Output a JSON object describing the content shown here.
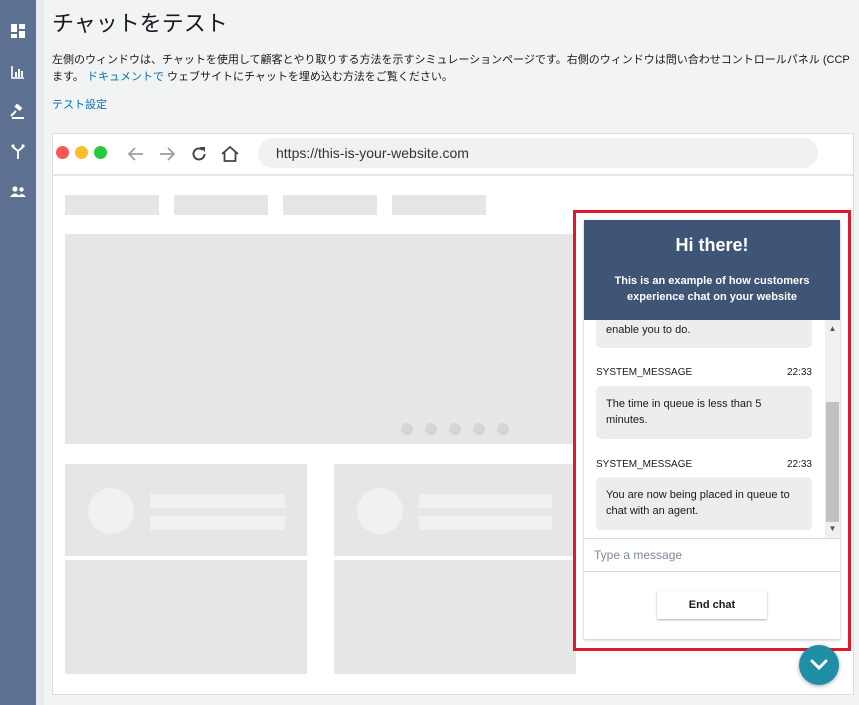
{
  "sidebar": {
    "icons": [
      "dashboard-icon",
      "metrics-icon",
      "routing-icon",
      "flow-icon",
      "users-icon"
    ]
  },
  "page": {
    "title": "チャットをテスト",
    "desc_line1": "左側のウィンドウは、チャットを使用して顧客とやり取りする方法を示すシミュレーションページです。右側のウィンドウは問い合わせコントロールパネル (CCP",
    "desc_line2_a": "ます。",
    "desc_link": "ドキュメントで",
    "desc_line2_b": "ウェブサイトにチャットを埋め込む方法をご覧ください。",
    "settings_link": "テスト設定"
  },
  "browser": {
    "url": "https://this-is-your-website.com",
    "dot_colors": [
      "#f45a52",
      "#f9be2d",
      "#28c840"
    ]
  },
  "chat": {
    "header_title": "Hi there!",
    "header_sub": "This is an example of how customers experience chat on your website",
    "messages": [
      {
        "text": "enable you to do."
      },
      {
        "sender": "SYSTEM_MESSAGE",
        "time": "22:33",
        "text": "The time in queue is less than 5 minutes."
      },
      {
        "sender": "SYSTEM_MESSAGE",
        "time": "22:33",
        "text": "You are now being placed in queue to chat with an agent."
      }
    ],
    "input_placeholder": "Type a message",
    "end_chat_label": "End chat"
  },
  "fab": {
    "icon": "chevron-down-icon"
  }
}
